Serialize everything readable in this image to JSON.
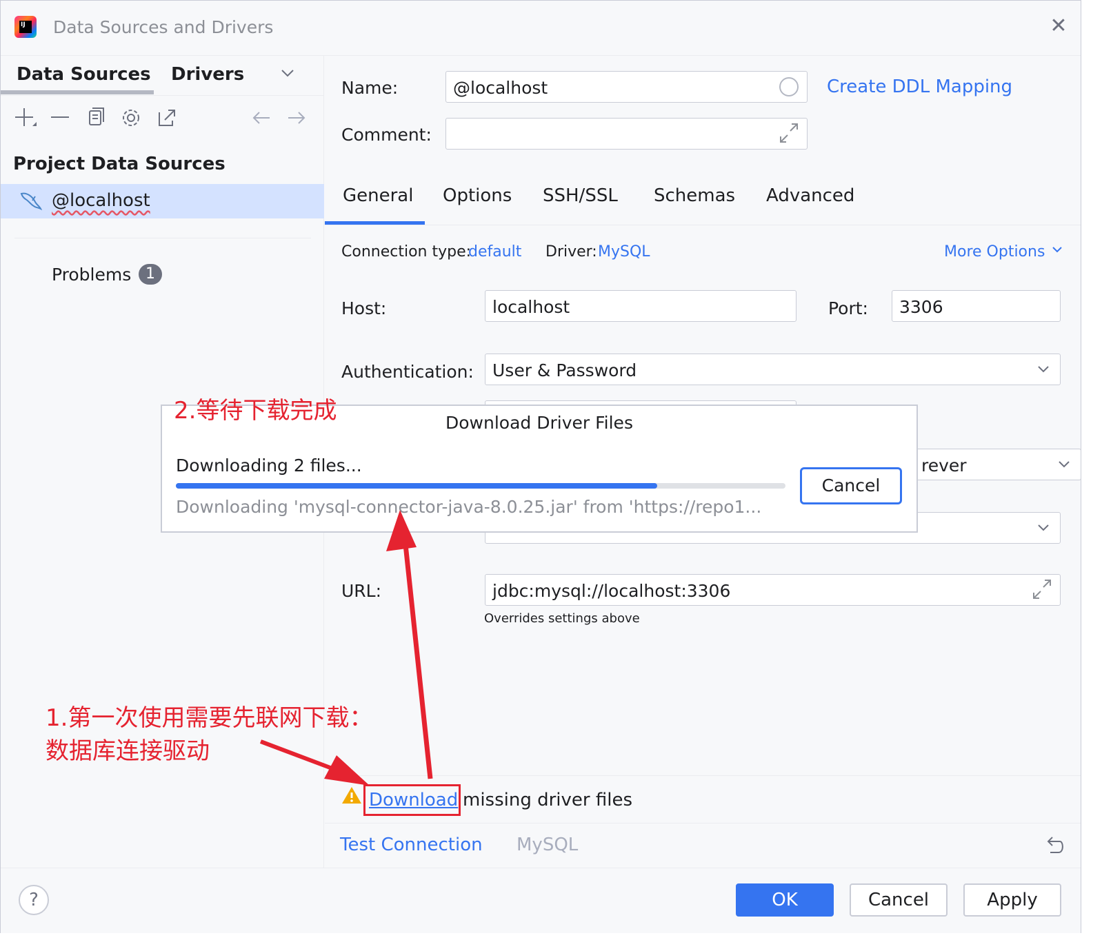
{
  "window": {
    "title": "Data Sources and Drivers",
    "app_icon_letters": "IJ"
  },
  "left_panel": {
    "tabs": [
      {
        "label": "Data Sources",
        "active": true
      },
      {
        "label": "Drivers",
        "active": false
      }
    ],
    "toolbar_icons": [
      "add-icon",
      "remove-icon",
      "duplicate-icon",
      "settings-icon",
      "open-external-icon",
      "back-arrow-icon",
      "forward-arrow-icon"
    ],
    "section_title": "Project Data Sources",
    "data_sources": [
      {
        "label": "@localhost",
        "icon": "mysql-dolphin-icon",
        "selected": true
      }
    ],
    "problems": {
      "label": "Problems",
      "count": "1"
    }
  },
  "right_panel": {
    "name_label": "Name:",
    "name_value": "@localhost",
    "ddl_link": "Create DDL Mapping",
    "comment_label": "Comment:",
    "comment_value": "",
    "tabs": [
      {
        "label": "General",
        "active": true
      },
      {
        "label": "Options",
        "active": false
      },
      {
        "label": "SSH/SSL",
        "active": false
      },
      {
        "label": "Schemas",
        "active": false
      },
      {
        "label": "Advanced",
        "active": false
      }
    ],
    "connection_type_label": "Connection type:",
    "connection_type_value": "default",
    "driver_label": "Driver:",
    "driver_value": "MySQL",
    "more_options": "More Options",
    "host_label": "Host:",
    "host_value": "localhost",
    "port_label": "Port:",
    "port_value": "3306",
    "auth_label": "Authentication:",
    "auth_value": "User & Password",
    "save_value_partial": "rever",
    "url_label": "URL:",
    "url_value": "jdbc:mysql://localhost:3306",
    "url_hint": "Overrides settings above",
    "warning": {
      "link": "Download",
      "text": "missing driver files"
    },
    "test_connection": "Test Connection",
    "driver_footer": "MySQL"
  },
  "bottom_bar": {
    "help": "?",
    "ok": "OK",
    "cancel": "Cancel",
    "apply": "Apply"
  },
  "download_dialog": {
    "title": "Download Driver Files",
    "status": "Downloading 2 files...",
    "progress": 0.79,
    "detail": "Downloading 'mysql-connector-java-8.0.25.jar' from 'https://repo1...",
    "cancel": "Cancel"
  },
  "annotations": {
    "step2": "2.等待下载完成",
    "step1_line1": "1.第一次使用需要先联网下载：",
    "step1_line2": "数据库连接驱动"
  },
  "colors": {
    "accent": "#3574f0",
    "annotation_red": "#e52330",
    "selection": "#d4e2ff",
    "warning": "#f2a900"
  }
}
